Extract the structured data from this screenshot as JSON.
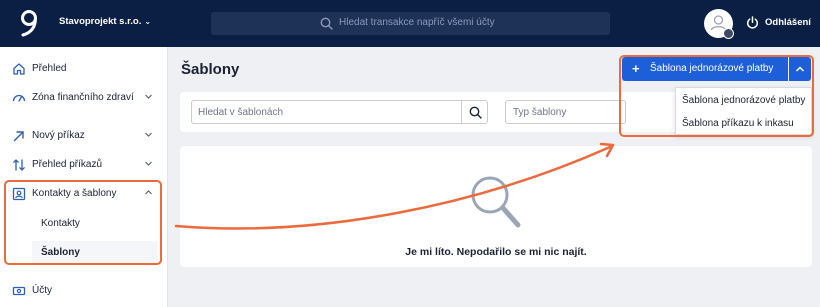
{
  "topbar": {
    "company_name": "Stavoprojekt s.r.o.",
    "search_placeholder": "Hledat transakce napříč všemi účty",
    "logout_label": "Odhlášení"
  },
  "sidebar": {
    "items": [
      {
        "label": "Přehled",
        "icon": "home-icon"
      },
      {
        "label": "Zóna finančního zdraví",
        "icon": "gauge-icon"
      },
      {
        "label": "Nový příkaz",
        "icon": "arrow-up-right-icon"
      },
      {
        "label": "Přehled příkazů",
        "icon": "transfer-arrows-icon"
      },
      {
        "label": "Kontakty a šablony",
        "icon": "contact-card-icon"
      },
      {
        "label": "Účty",
        "icon": "money-icon"
      }
    ],
    "subitems": [
      {
        "label": "Kontakty"
      },
      {
        "label": "Šablony"
      }
    ]
  },
  "main": {
    "title": "Šablony",
    "primary_button_label": "Šablona jednorázové platby",
    "filter_placeholder": "Hledat v šablonách",
    "type_placeholder": "Typ šablony",
    "dropdown_options": [
      {
        "label": "Šablona jednorázové platby"
      },
      {
        "label": "Šablona příkazu k inkasu"
      }
    ],
    "empty_message": "Je mi líto. Nepodařilo se mi nic najít."
  },
  "colors": {
    "topbar": "#0b1f45",
    "primary": "#1d5fd9",
    "highlight": "#ec6a3c"
  }
}
